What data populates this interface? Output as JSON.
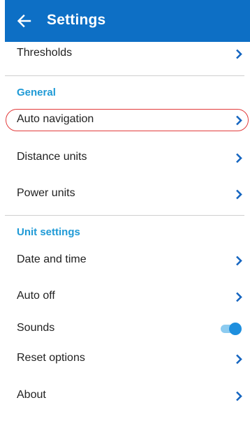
{
  "app_bar": {
    "back_icon": "arrow-left-icon",
    "title": "Settings"
  },
  "colors": {
    "app_bar": "#0d6fc5",
    "section_header": "#1f9ad6",
    "chevron": "#1565c0",
    "toggle_on": "#1e8fde",
    "highlight": "#e23b3b"
  },
  "rows": {
    "thresholds": "Thresholds",
    "auto_navigation": "Auto navigation",
    "distance_units": "Distance units",
    "power_units": "Power units",
    "date_and_time": "Date and time",
    "auto_off": "Auto off",
    "sounds": "Sounds",
    "reset_options": "Reset options",
    "about": "About"
  },
  "sections": {
    "general": "General",
    "unit_settings": "Unit settings"
  },
  "toggles": {
    "sounds_on": true
  },
  "icons": {
    "chevron": "chevron-right-icon"
  }
}
